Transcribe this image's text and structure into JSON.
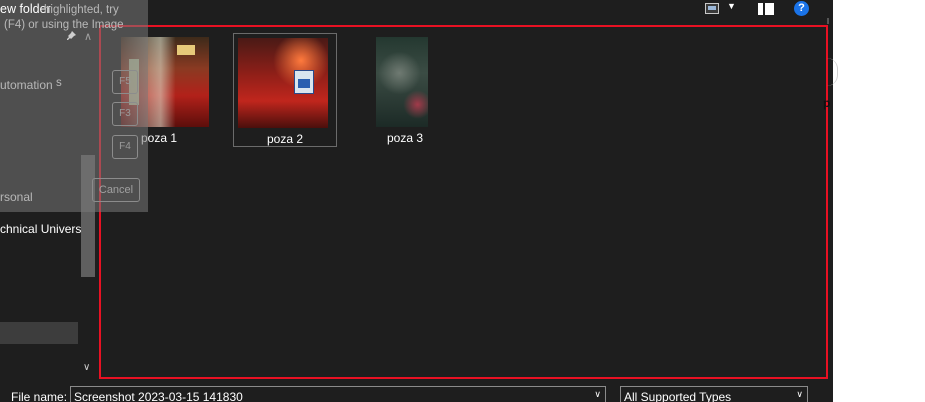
{
  "nav": {
    "items": [
      {
        "label": "utomation"
      },
      {
        "label": "rsonal"
      },
      {
        "label": "chnical Universi"
      }
    ]
  },
  "overlay": {
    "title": "ew folder",
    "line1": "highlighted, try",
    "line2": "(F4) or using the Image",
    "line3": "s",
    "keys": [
      "F5",
      "F3",
      "F4"
    ],
    "cancel_label": "Cancel"
  },
  "toolbar": {
    "icons": [
      "view-mode-icon",
      "chevron-down-icon",
      "preview-pane-icon",
      "help-icon"
    ],
    "help_glyph": "?"
  },
  "files": [
    {
      "name": "poza 1"
    },
    {
      "name": "poza 2",
      "selected": true
    },
    {
      "name": "poza 3"
    }
  ],
  "bottom": {
    "file_name_label": "File name:",
    "file_name_value": "Screenshot 2023-03-15 141830",
    "file_type_value": "All Supported Types"
  },
  "right_strip": {
    "partial_text": "p"
  },
  "colors": {
    "background": "#1e1e1e",
    "highlight_border": "#e81123",
    "help_blue": "#1a73e8"
  }
}
